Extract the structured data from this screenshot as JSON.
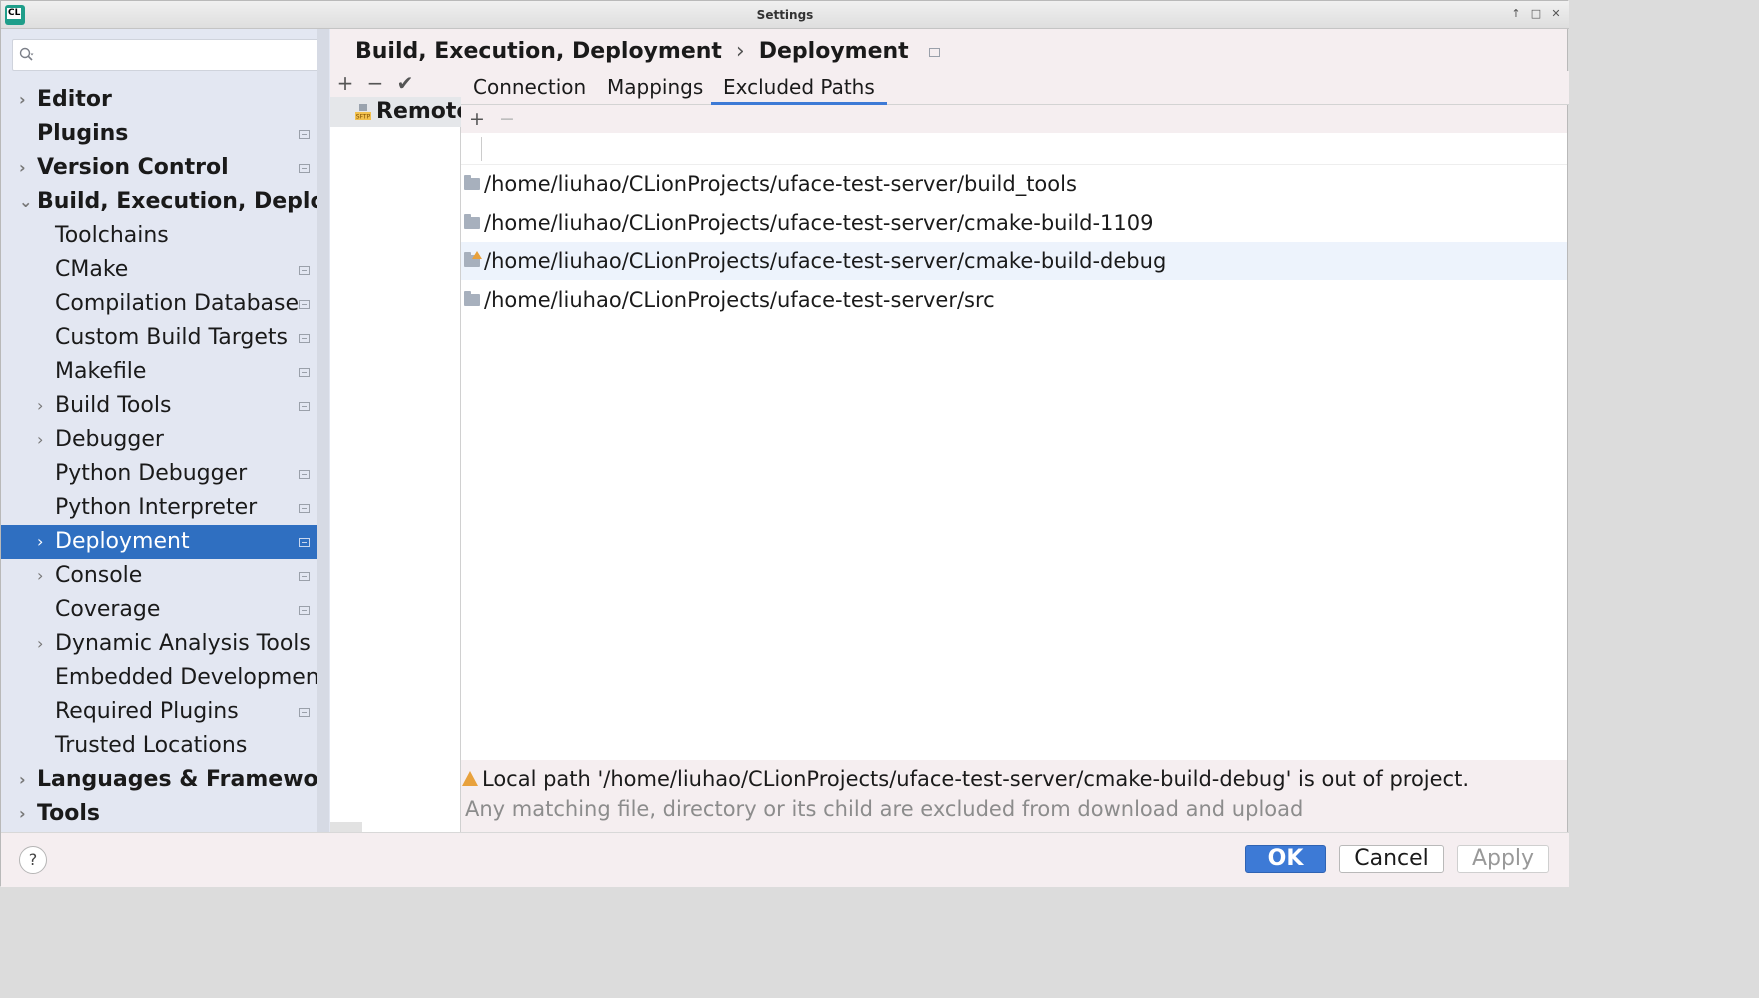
{
  "window": {
    "title": "Settings",
    "controls": [
      "↑",
      "□",
      "✕"
    ]
  },
  "search": {
    "placeholder": ""
  },
  "sidebar": {
    "items": [
      {
        "label": "Editor",
        "bold": true,
        "chevron": "›",
        "level": 0,
        "project": false
      },
      {
        "label": "Plugins",
        "bold": true,
        "chevron": "",
        "level": 0,
        "project": true
      },
      {
        "label": "Version Control",
        "bold": true,
        "chevron": "›",
        "level": 0,
        "project": true
      },
      {
        "label": "Build, Execution, Deplo",
        "bold": true,
        "chevron": "⌄",
        "level": 0,
        "project": false
      },
      {
        "label": "Toolchains",
        "bold": false,
        "chevron": "",
        "level": 1,
        "project": false
      },
      {
        "label": "CMake",
        "bold": false,
        "chevron": "",
        "level": 1,
        "project": true
      },
      {
        "label": "Compilation Database",
        "bold": false,
        "chevron": "",
        "level": 1,
        "project": true
      },
      {
        "label": "Custom Build Targets",
        "bold": false,
        "chevron": "",
        "level": 1,
        "project": true
      },
      {
        "label": "Makefile",
        "bold": false,
        "chevron": "",
        "level": 1,
        "project": true
      },
      {
        "label": "Build Tools",
        "bold": false,
        "chevron": "›",
        "level": 1,
        "project": true
      },
      {
        "label": "Debugger",
        "bold": false,
        "chevron": "›",
        "level": 1,
        "project": false
      },
      {
        "label": "Python Debugger",
        "bold": false,
        "chevron": "",
        "level": 1,
        "project": true
      },
      {
        "label": "Python Interpreter",
        "bold": false,
        "chevron": "",
        "level": 1,
        "project": true
      },
      {
        "label": "Deployment",
        "bold": false,
        "chevron": "›",
        "level": 1,
        "project": true,
        "selected": true
      },
      {
        "label": "Console",
        "bold": false,
        "chevron": "›",
        "level": 1,
        "project": true
      },
      {
        "label": "Coverage",
        "bold": false,
        "chevron": "",
        "level": 1,
        "project": true
      },
      {
        "label": "Dynamic Analysis Tools",
        "bold": false,
        "chevron": "›",
        "level": 1,
        "project": false
      },
      {
        "label": "Embedded Developmen",
        "bold": false,
        "chevron": "",
        "level": 1,
        "project": false
      },
      {
        "label": "Required Plugins",
        "bold": false,
        "chevron": "",
        "level": 1,
        "project": true
      },
      {
        "label": "Trusted Locations",
        "bold": false,
        "chevron": "",
        "level": 1,
        "project": false
      },
      {
        "label": "Languages & Framewo",
        "bold": true,
        "chevron": "›",
        "level": 0,
        "project": false
      },
      {
        "label": "Tools",
        "bold": true,
        "chevron": "›",
        "level": 0,
        "project": false
      }
    ]
  },
  "breadcrumb": {
    "parent": "Build, Execution, Deployment",
    "separator": "›",
    "current": "Deployment"
  },
  "servers": {
    "toolbar": {
      "add": "+",
      "remove": "−",
      "default": "✔"
    },
    "items": [
      {
        "name": "Remote",
        "icon": "sftp-icon",
        "icon_text": "SFTP"
      }
    ]
  },
  "tabs": [
    {
      "label": "Connection",
      "active": false
    },
    {
      "label": "Mappings",
      "active": false
    },
    {
      "label": "Excluded Paths",
      "active": true
    }
  ],
  "excluded": {
    "toolbar": {
      "add": "+",
      "remove": "−"
    },
    "paths": [
      {
        "path": "/home/liuhao/CLionProjects/uface-test-server/build_tools",
        "warning": false
      },
      {
        "path": "/home/liuhao/CLionProjects/uface-test-server/cmake-build-1109",
        "warning": false
      },
      {
        "path": "/home/liuhao/CLionProjects/uface-test-server/cmake-build-debug",
        "warning": true
      },
      {
        "path": "/home/liuhao/CLionProjects/uface-test-server/src",
        "warning": false
      }
    ]
  },
  "warning": "Local path '/home/liuhao/CLionProjects/uface-test-server/cmake-build-debug' is out of project.",
  "info": "Any matching file, directory or its child are excluded from download and upload",
  "buttons": {
    "help": "?",
    "ok": "OK",
    "cancel": "Cancel",
    "apply": "Apply"
  },
  "colors": {
    "selection": "#2f6fc1",
    "accent": "#3d7ad6",
    "warning": "#e8a13c"
  }
}
